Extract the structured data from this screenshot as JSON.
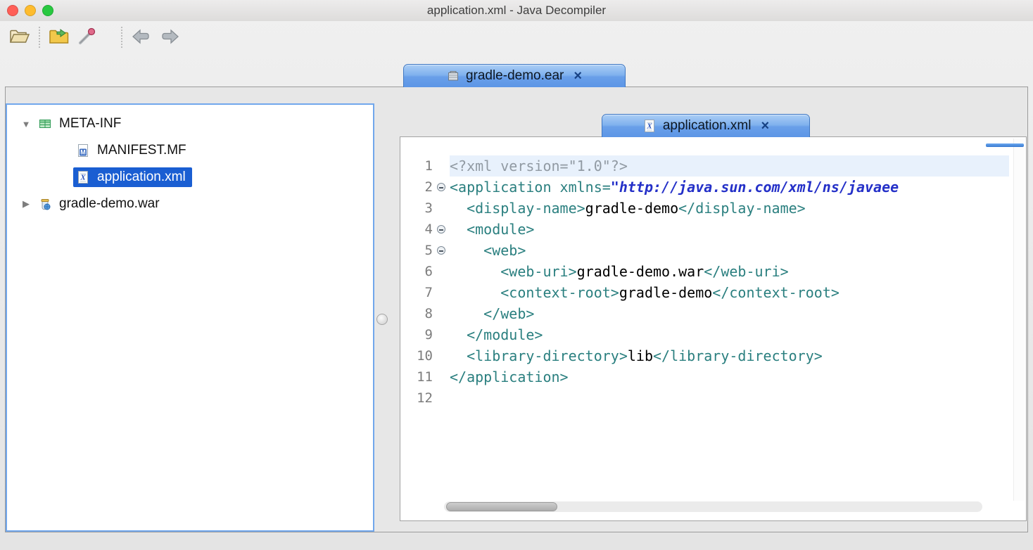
{
  "window": {
    "title": "application.xml - Java Decompiler"
  },
  "toolbar": {
    "buttons": [
      {
        "id": "open-file",
        "icon": "open-folder-icon",
        "enabled": true
      },
      {
        "id": "open-type",
        "icon": "open-type-icon",
        "enabled": true
      },
      {
        "id": "search",
        "icon": "search-wand-icon",
        "enabled": true
      },
      {
        "id": "back",
        "icon": "back-arrow-icon",
        "enabled": false
      },
      {
        "id": "forward",
        "icon": "forward-arrow-icon",
        "enabled": false
      }
    ]
  },
  "archive_tab": {
    "label": "gradle-demo.ear",
    "close_glyph": "×",
    "icon": "ear-archive-icon"
  },
  "tree": {
    "items": [
      {
        "label": "META-INF",
        "level": 0,
        "disclosure": "expanded",
        "icon": "package-icon",
        "selected": false
      },
      {
        "label": "MANIFEST.MF",
        "level": 1,
        "disclosure": "none",
        "icon": "manifest-file-icon",
        "selected": false
      },
      {
        "label": "application.xml",
        "level": 1,
        "disclosure": "none",
        "icon": "xml-file-icon",
        "selected": true
      },
      {
        "label": "gradle-demo.war",
        "level": 0,
        "disclosure": "collapsed",
        "icon": "war-file-icon",
        "selected": false
      }
    ]
  },
  "editor": {
    "tab": {
      "label": "application.xml",
      "close_glyph": "×",
      "icon": "xml-file-icon"
    },
    "colors": {
      "tag": "#2a7f7f",
      "attr_value": "#2430c8",
      "declaration": "#919aa3",
      "text": "#000000",
      "line_number": "#7c7c7c",
      "current_line_bg": "#e8f1fc"
    },
    "lines": [
      {
        "num": "1",
        "fold": false,
        "current": true,
        "segments": [
          {
            "text": "<?xml version=\"1.0\"?>",
            "style": "declaration"
          }
        ]
      },
      {
        "num": "2",
        "fold": true,
        "segments": [
          {
            "text": "<application xmlns=",
            "style": "tag"
          },
          {
            "text": "\"http://java.sun.com/xml/ns/javaee",
            "style": "attr_value"
          }
        ]
      },
      {
        "num": "3",
        "segments": [
          {
            "text": "  <display-name>",
            "style": "tag"
          },
          {
            "text": "gradle-demo",
            "style": "text"
          },
          {
            "text": "</display-name>",
            "style": "tag"
          }
        ]
      },
      {
        "num": "4",
        "fold": true,
        "segments": [
          {
            "text": "  <module>",
            "style": "tag"
          }
        ]
      },
      {
        "num": "5",
        "fold": true,
        "segments": [
          {
            "text": "    <web>",
            "style": "tag"
          }
        ]
      },
      {
        "num": "6",
        "segments": [
          {
            "text": "      <web-uri>",
            "style": "tag"
          },
          {
            "text": "gradle-demo.war",
            "style": "text"
          },
          {
            "text": "</web-uri>",
            "style": "tag"
          }
        ]
      },
      {
        "num": "7",
        "segments": [
          {
            "text": "      <context-root>",
            "style": "tag"
          },
          {
            "text": "gradle-demo",
            "style": "text"
          },
          {
            "text": "</context-root>",
            "style": "tag"
          }
        ]
      },
      {
        "num": "8",
        "segments": [
          {
            "text": "    </web>",
            "style": "tag"
          }
        ]
      },
      {
        "num": "9",
        "segments": [
          {
            "text": "  </module>",
            "style": "tag"
          }
        ]
      },
      {
        "num": "10",
        "segments": [
          {
            "text": "  <library-directory>",
            "style": "tag"
          },
          {
            "text": "lib",
            "style": "text"
          },
          {
            "text": "</library-directory>",
            "style": "tag"
          }
        ]
      },
      {
        "num": "11",
        "segments": [
          {
            "text": "</application>",
            "style": "tag"
          }
        ]
      },
      {
        "num": "12",
        "segments": []
      }
    ]
  }
}
